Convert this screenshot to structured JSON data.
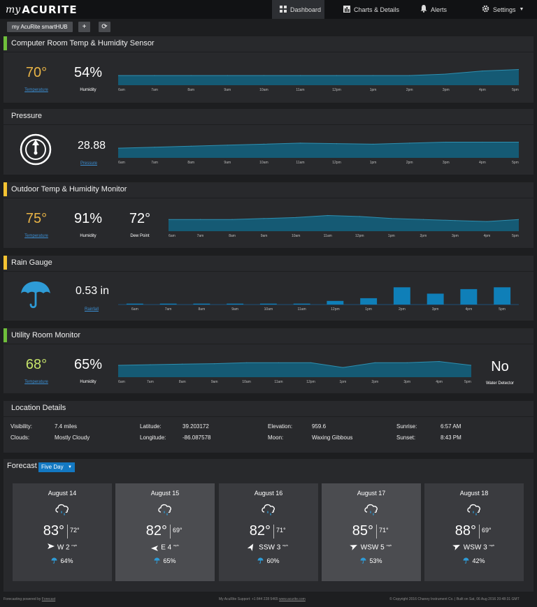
{
  "brand": {
    "my": "my",
    "name": "ACURITE"
  },
  "nav": {
    "dashboard": "Dashboard",
    "charts": "Charts & Details",
    "alerts": "Alerts",
    "settings": "Settings"
  },
  "hub": {
    "tab_label": "my AcuRite smartHUB",
    "add_label": "+",
    "refresh_label": "⟳"
  },
  "panels": {
    "computer_room": {
      "title": "Computer Room Temp & Humidity Sensor",
      "temperature": "70°",
      "temperature_label": "Temperature",
      "humidity": "54%",
      "humidity_label": "Humidity"
    },
    "pressure": {
      "title": "Pressure",
      "value": "28.88",
      "label": "Pressure"
    },
    "outdoor": {
      "title": "Outdoor Temp & Humidity Monitor",
      "temperature": "75°",
      "temperature_label": "Temperature",
      "humidity": "91%",
      "humidity_label": "Humidity",
      "dew_point": "72°",
      "dew_point_label": "Dew Point"
    },
    "rain": {
      "title": "Rain Gauge",
      "value": "0.53 in",
      "label": "Rainfall"
    },
    "utility_room": {
      "title": "Utility Room Monitor",
      "temperature": "68°",
      "temperature_label": "Temperature",
      "humidity": "65%",
      "humidity_label": "Humidity",
      "water": "No",
      "water_label": "Water Detector"
    }
  },
  "chart_data": [
    {
      "type": "area",
      "x": [
        "6am",
        "7am",
        "8am",
        "9am",
        "10am",
        "11am",
        "12pm",
        "1pm",
        "2pm",
        "3pm",
        "4pm",
        "5pm"
      ],
      "values": [
        54,
        54,
        54,
        54,
        54,
        54,
        54,
        54,
        54,
        55,
        57,
        58
      ]
    },
    {
      "type": "area",
      "x": [
        "6am",
        "7am",
        "8am",
        "9am",
        "10am",
        "11am",
        "12pm",
        "1pm",
        "2pm",
        "3pm",
        "4pm",
        "5pm"
      ],
      "values": [
        28.7,
        28.72,
        28.74,
        28.76,
        28.78,
        28.8,
        28.79,
        28.78,
        28.8,
        28.82,
        28.82,
        28.82
      ]
    },
    {
      "type": "area",
      "x": [
        "6am",
        "7am",
        "8am",
        "9am",
        "10am",
        "11am",
        "12pm",
        "1pm",
        "2pm",
        "3pm",
        "4pm",
        "5pm"
      ],
      "values": [
        88,
        88,
        88,
        88.5,
        89,
        90,
        89.5,
        88.5,
        88,
        87.5,
        87,
        88
      ]
    },
    {
      "type": "bar",
      "categories": [
        "6am",
        "7am",
        "8am",
        "9am",
        "10am",
        "11am",
        "12pm",
        "1pm",
        "2pm",
        "3pm",
        "4pm",
        "5pm"
      ],
      "values": [
        0.01,
        0.01,
        0.01,
        0.01,
        0.01,
        0.01,
        0.04,
        0.07,
        0.19,
        0.12,
        0.17,
        0.19
      ]
    },
    {
      "type": "area",
      "x": [
        "6am",
        "7am",
        "8am",
        "9am",
        "10am",
        "11am",
        "12pm",
        "1pm",
        "2pm",
        "3pm",
        "4pm",
        "5pm"
      ],
      "values": [
        64,
        64.3,
        64.6,
        64.8,
        65.2,
        65.2,
        65.2,
        63,
        65.2,
        65.2,
        65.8,
        64
      ]
    }
  ],
  "location": {
    "title": "Location Details",
    "visibility_label": "Visibility:",
    "visibility": "7.4 miles",
    "clouds_label": "Clouds:",
    "clouds": "Mostly Cloudy",
    "latitude_label": "Latitude:",
    "latitude": "39.203172",
    "longitude_label": "Longitude:",
    "longitude": "-86.087578",
    "elevation_label": "Elevation:",
    "elevation": "959.6",
    "moon_label": "Moon:",
    "moon": "Waxing Gibbous",
    "sunrise_label": "Sunrise:",
    "sunrise": "6:57 AM",
    "sunset_label": "Sunset:",
    "sunset": "8:43 PM"
  },
  "forecast": {
    "title": "Forecast",
    "range": "Five Day",
    "days": [
      {
        "date": "August 14",
        "high": "83°",
        "low": "72°",
        "wind": "W 2",
        "mph": "mph",
        "rain": "64%"
      },
      {
        "date": "August 15",
        "high": "82°",
        "low": "69°",
        "wind": "E 4",
        "mph": "mph",
        "rain": "65%"
      },
      {
        "date": "August 16",
        "high": "82°",
        "low": "71°",
        "wind": "SSW 3",
        "mph": "mph",
        "rain": "60%"
      },
      {
        "date": "August 17",
        "high": "85°",
        "low": "71°",
        "wind": "WSW 5",
        "mph": "mph",
        "rain": "53%"
      },
      {
        "date": "August 18",
        "high": "88°",
        "low": "69°",
        "wind": "WSW 3",
        "mph": "mph",
        "rain": "42%"
      }
    ]
  },
  "footer": {
    "left": "Forecasting powered by",
    "left_link": "Forecast",
    "center": "My AcuRite Support: +1 844 228 5465",
    "center_link": "www.acurite.com",
    "right": "© Copyright 2016 Chaney Instrument Co. | Built on Sat, 06 Aug 2016 20:48:31 GMT"
  },
  "colors": {
    "accent": "#1378c2",
    "chart_fill": "#155a74",
    "chart_line": "#2e8fb0",
    "green": "#6fbf3b",
    "yellow": "#f4c332"
  }
}
